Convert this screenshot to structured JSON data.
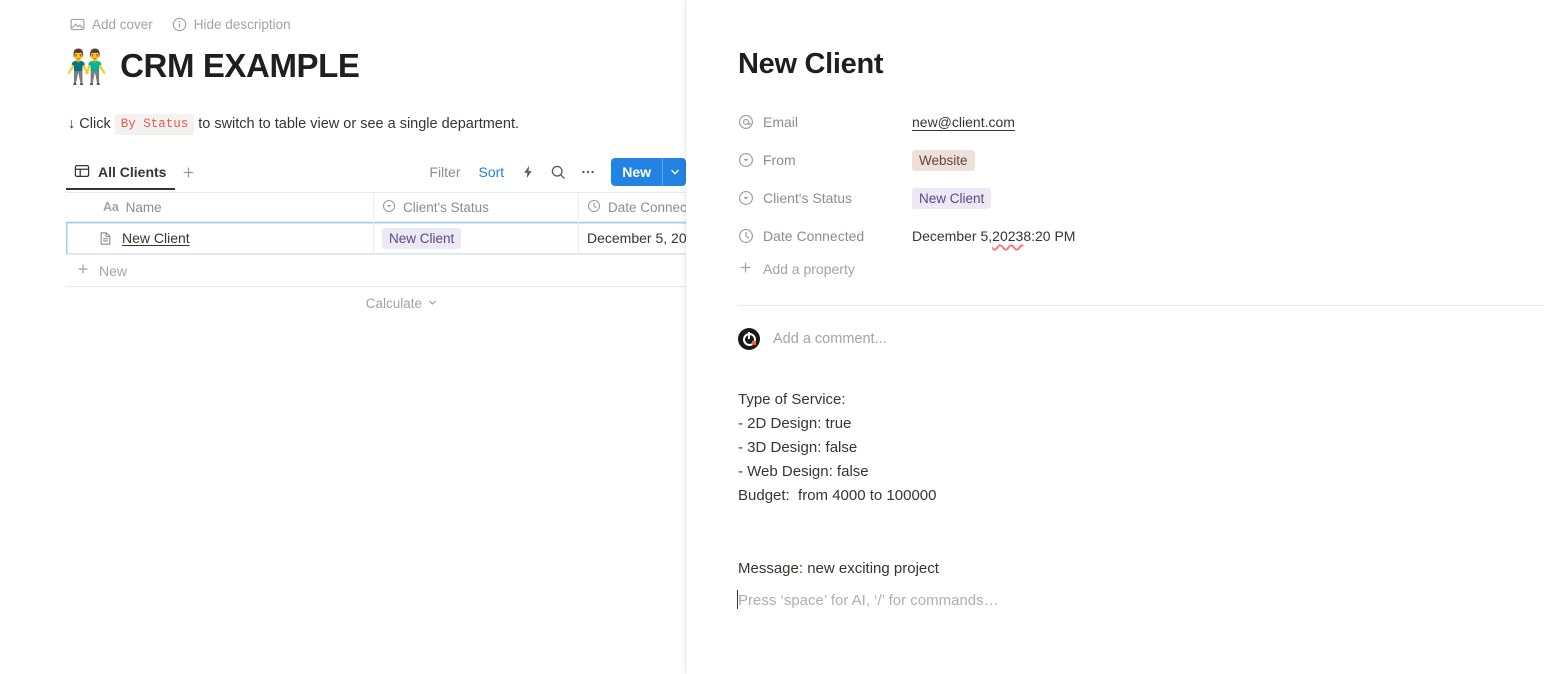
{
  "page": {
    "actions": [
      {
        "icon": "image-icon",
        "label": "Add cover"
      },
      {
        "icon": "info-icon",
        "label": "Hide description"
      }
    ],
    "emoji": "👬",
    "title": "CRM EXAMPLE",
    "description": {
      "before": "↓ Click",
      "code": "By Status",
      "after": "to switch to table view or see a single department."
    }
  },
  "toolbar": {
    "tab_label": "All Clients",
    "tab_icon": "table-icon",
    "add_view_icon": "plus-icon",
    "filter_label": "Filter",
    "sort_label": "Sort",
    "automation_icon": "lightning-icon",
    "search_icon": "search-icon",
    "more_icon": "ellipsis-icon",
    "new_label": "New",
    "new_caret_icon": "chevron-down-icon",
    "accent_blue": "#2383e2",
    "sort_color": "#2383e2"
  },
  "table": {
    "columns": [
      {
        "icon": "text-aa-icon",
        "label": "Name"
      },
      {
        "icon": "select-icon",
        "label": "Client's Status"
      },
      {
        "icon": "clock-icon",
        "label": "Date Connec"
      }
    ],
    "rows": [
      {
        "icon": "page-icon",
        "name": "New Client",
        "status": "New Client",
        "status_color": "#ece9f5",
        "date": "December 5, 20"
      }
    ],
    "new_row_label": "New",
    "new_row_icon": "plus-icon",
    "calculate_label": "Calculate",
    "calculate_icon": "chevron-down-icon"
  },
  "peek": {
    "title": "New Client",
    "properties": [
      {
        "icon": "at-icon",
        "label": "Email",
        "value": "new@client.com",
        "type": "link"
      },
      {
        "icon": "select-icon",
        "label": "From",
        "value": "Website",
        "type": "pill-beige"
      },
      {
        "icon": "select-icon",
        "label": "Client's Status",
        "value": "New Client",
        "type": "pill-purple"
      },
      {
        "icon": "clock-icon",
        "label": "Date Connected",
        "value": "December 5, 2023 8:20 PM",
        "type": "date"
      }
    ],
    "date_parts": {
      "pre": "December 5, ",
      "misspelled": "2023",
      "post": " 8:20 PM"
    },
    "add_property_label": "Add a property",
    "add_property_icon": "plus-icon",
    "comment_placeholder": "Add a comment...",
    "avatar_icon": "user-avatar",
    "body_text": "Type of Service:\n- 2D Design: true\n- 3D Design: false\n- Web Design: false\nBudget:  from 4000 to 100000",
    "body_message": "Message: new exciting project",
    "body_placeholder": "Press ‘space’ for AI, ‘/’ for commands…"
  }
}
